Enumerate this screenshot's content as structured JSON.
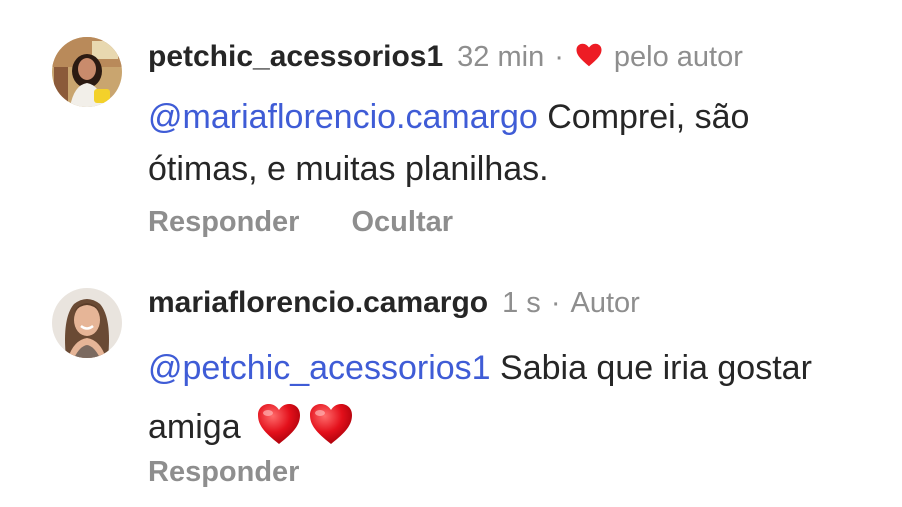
{
  "comments": [
    {
      "username": "petchic_acessorios1",
      "time": "32 min",
      "separator": "·",
      "like_label": "pelo autor",
      "mention": "@mariaflorencio.camargo",
      "text": " Comprei, são ótimas, e muitas planilhas.",
      "actions": [
        "Responder",
        "Ocultar"
      ]
    },
    {
      "username": "mariaflorencio.camargo",
      "time": "1 s",
      "separator": "·",
      "role": "Autor",
      "mention": "@petchic_acessorios1",
      "text": " Sabia que iria gostar amiga ",
      "emojis": [
        "red-heart",
        "red-heart"
      ],
      "actions": [
        "Responder"
      ]
    }
  ],
  "colors": {
    "text": "#262626",
    "muted": "#8e8e8e",
    "mention": "#3f5cd6",
    "heart": "#ed1c24"
  }
}
